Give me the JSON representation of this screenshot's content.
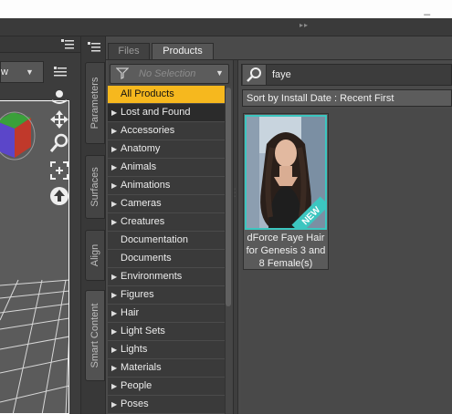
{
  "window": {
    "minimize_glyph": "_"
  },
  "viewport": {
    "camera_dropdown": "w",
    "dropdown_arrow": "▼",
    "tools": [
      "orbit-icon",
      "translate-icon",
      "zoom-icon",
      "frame-icon",
      "reset-icon"
    ]
  },
  "side_tabs": [
    {
      "label": "Parameters"
    },
    {
      "label": "Surfaces"
    },
    {
      "label": "Align"
    },
    {
      "label": "Smart Content"
    }
  ],
  "content_tabs": {
    "files": "Files",
    "products": "Products"
  },
  "filter": {
    "placeholder": "No Selection",
    "arrow": "▼"
  },
  "categories": [
    {
      "label": "All Products",
      "expandable": false,
      "selected": true
    },
    {
      "label": "Lost and Found",
      "expandable": true
    },
    {
      "label": "Accessories",
      "expandable": true
    },
    {
      "label": "Anatomy",
      "expandable": true
    },
    {
      "label": "Animals",
      "expandable": true
    },
    {
      "label": "Animations",
      "expandable": true
    },
    {
      "label": "Cameras",
      "expandable": true
    },
    {
      "label": "Creatures",
      "expandable": true
    },
    {
      "label": "Documentation",
      "expandable": false
    },
    {
      "label": "Documents",
      "expandable": false
    },
    {
      "label": "Environments",
      "expandable": true
    },
    {
      "label": "Figures",
      "expandable": true
    },
    {
      "label": "Hair",
      "expandable": true
    },
    {
      "label": "Light Sets",
      "expandable": true
    },
    {
      "label": "Lights",
      "expandable": true
    },
    {
      "label": "Materials",
      "expandable": true
    },
    {
      "label": "People",
      "expandable": true
    },
    {
      "label": "Poses",
      "expandable": true
    }
  ],
  "search": {
    "value": "faye"
  },
  "sort": {
    "label": "Sort by Install Date : Recent First"
  },
  "products": [
    {
      "name_lines": [
        "dForce Faye Hair",
        "for Genesis 3 and",
        "8 Female(s)"
      ],
      "badge": "NEW"
    }
  ],
  "colors": {
    "selected_category": "#f6b81e",
    "thumb_border": "#3cc6c0"
  }
}
